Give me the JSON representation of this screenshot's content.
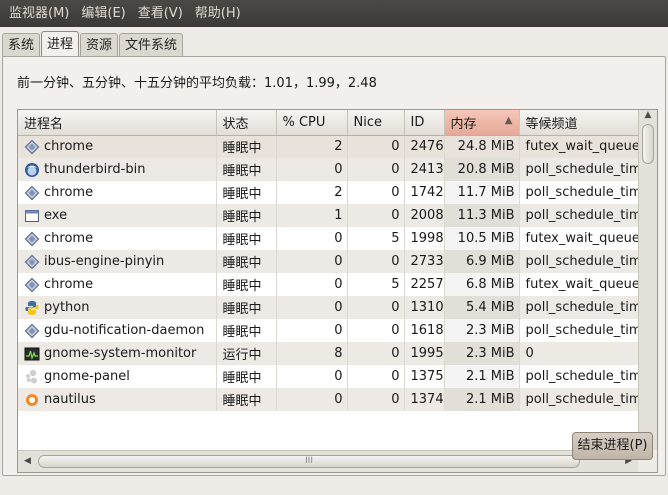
{
  "menubar": {
    "items": [
      {
        "label": "监视器(M)"
      },
      {
        "label": "编辑(E)"
      },
      {
        "label": "查看(V)"
      },
      {
        "label": "帮助(H)"
      }
    ]
  },
  "tabs": [
    {
      "label": "系统",
      "active": false
    },
    {
      "label": "进程",
      "active": true
    },
    {
      "label": "资源",
      "active": false
    },
    {
      "label": "文件系统",
      "active": false
    }
  ],
  "load_average": "前一分钟、五分钟、十五分钟的平均负载：1.01，1.99，2.48",
  "table": {
    "columns": [
      "进程名",
      "状态",
      "% CPU",
      "Nice",
      "ID",
      "内存",
      "等候频道"
    ],
    "sorted_column": "内存",
    "sort_indicator": "▲",
    "rows": [
      {
        "icon": "chrome-diamond-icon",
        "name": "chrome",
        "status": "睡眠中",
        "cpu": "2",
        "nice": "0",
        "id": "2476",
        "mem": "24.8 MiB",
        "wchan": "futex_wait_queue"
      },
      {
        "icon": "thunderbird-icon",
        "name": "thunderbird-bin",
        "status": "睡眠中",
        "cpu": "0",
        "nice": "0",
        "id": "2413",
        "mem": "20.8 MiB",
        "wchan": "poll_schedule_timeout"
      },
      {
        "icon": "chrome-diamond-icon",
        "name": "chrome",
        "status": "睡眠中",
        "cpu": "2",
        "nice": "0",
        "id": "1742",
        "mem": "11.7 MiB",
        "wchan": "poll_schedule_timeout"
      },
      {
        "icon": "window-icon",
        "name": "exe",
        "status": "睡眠中",
        "cpu": "1",
        "nice": "0",
        "id": "2008",
        "mem": "11.3 MiB",
        "wchan": "poll_schedule_timeout"
      },
      {
        "icon": "chrome-diamond-icon",
        "name": "chrome",
        "status": "睡眠中",
        "cpu": "0",
        "nice": "5",
        "id": "1998",
        "mem": "10.5 MiB",
        "wchan": "futex_wait_queue"
      },
      {
        "icon": "chrome-diamond-icon",
        "name": "ibus-engine-pinyin",
        "status": "睡眠中",
        "cpu": "0",
        "nice": "0",
        "id": "2733",
        "mem": "6.9 MiB",
        "wchan": "poll_schedule_timeout"
      },
      {
        "icon": "chrome-diamond-icon",
        "name": "chrome",
        "status": "睡眠中",
        "cpu": "0",
        "nice": "5",
        "id": "2257",
        "mem": "6.8 MiB",
        "wchan": "futex_wait_queue"
      },
      {
        "icon": "python-icon",
        "name": "python",
        "status": "睡眠中",
        "cpu": "0",
        "nice": "0",
        "id": "1310",
        "mem": "5.4 MiB",
        "wchan": "poll_schedule_timeout"
      },
      {
        "icon": "chrome-diamond-icon",
        "name": "gdu-notification-daemon",
        "status": "睡眠中",
        "cpu": "0",
        "nice": "0",
        "id": "1618",
        "mem": "2.3 MiB",
        "wchan": "poll_schedule_timeout"
      },
      {
        "icon": "system-monitor-icon",
        "name": "gnome-system-monitor",
        "status": "运行中",
        "cpu": "8",
        "nice": "0",
        "id": "1995",
        "mem": "2.3 MiB",
        "wchan": "0"
      },
      {
        "icon": "gnome-panel-icon",
        "name": "gnome-panel",
        "status": "睡眠中",
        "cpu": "0",
        "nice": "0",
        "id": "1375",
        "mem": "2.1 MiB",
        "wchan": "poll_schedule_timeout"
      },
      {
        "icon": "partial-icon",
        "name": "nautilus",
        "status": "睡眠中",
        "cpu": "0",
        "nice": "0",
        "id": "1374",
        "mem": "2.1 MiB",
        "wchan": "poll_schedule_timeout"
      }
    ]
  },
  "scrollbar_grip": "III",
  "buttons": {
    "end_process": "结束进程(P)"
  },
  "colors": {
    "menubar": "#3b3a36",
    "sorted_header": "#e6a898",
    "background": "#efebe7"
  }
}
